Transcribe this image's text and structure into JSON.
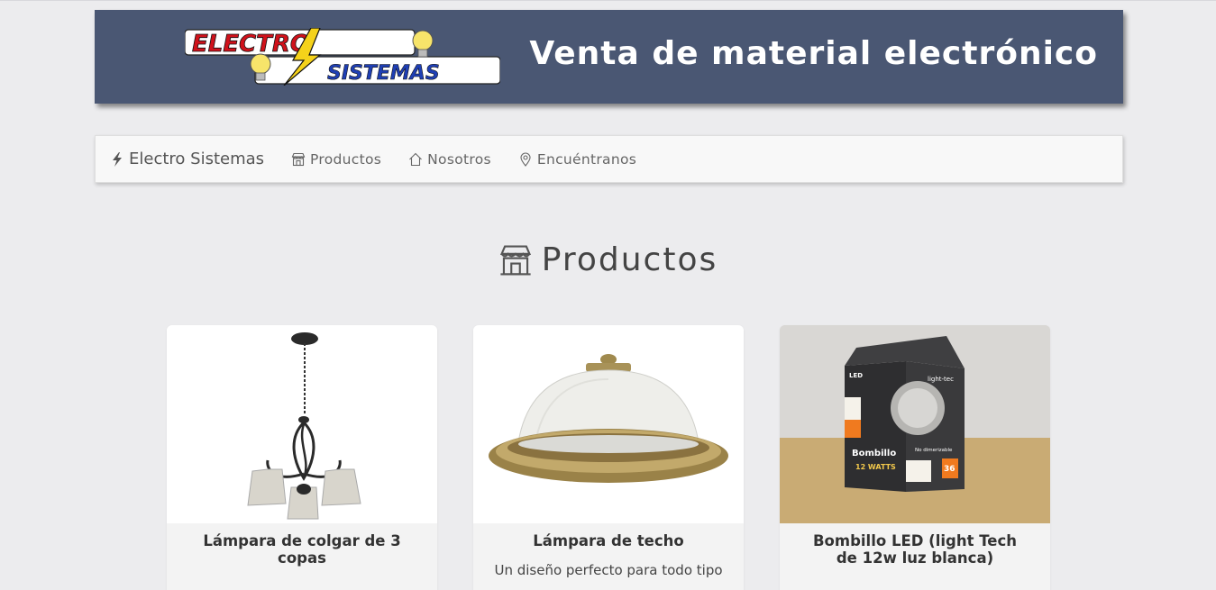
{
  "banner": {
    "logo_text_top": "ELECTRO",
    "logo_text_bottom": "SISTEMAS",
    "title": "Venta de material electrónico"
  },
  "navbar": {
    "brand": "Electro Sistemas",
    "items": [
      {
        "label": "Productos",
        "icon": "store-icon"
      },
      {
        "label": "Nosotros",
        "icon": "home-icon"
      },
      {
        "label": "Encuéntranos",
        "icon": "location-pin-icon"
      }
    ]
  },
  "section": {
    "title": "Productos",
    "icon": "store-icon"
  },
  "products": [
    {
      "title": "Lámpara de colgar de 3 copas",
      "description": "",
      "image": "chandelier-image"
    },
    {
      "title": "Lámpara de techo",
      "description": "Un diseño perfecto para todo tipo",
      "image": "ceiling-lamp-image"
    },
    {
      "title": "Bombillo LED (light Tech de 12w luz blanca)",
      "description": "",
      "image": "led-bulb-box-image",
      "box_text": {
        "brand": "light-tec",
        "led": "LED",
        "product": "Bombillo",
        "watts": "12 WATTS",
        "dim": "No dimerizable",
        "months": "36"
      }
    }
  ],
  "colors": {
    "banner_bg": "#4a5773",
    "page_bg": "#ececee",
    "navbar_bg": "#f8f8f8",
    "logo_red": "#d0121b",
    "logo_blue": "#1f3fb4",
    "logo_yellow": "#f5d21a"
  }
}
